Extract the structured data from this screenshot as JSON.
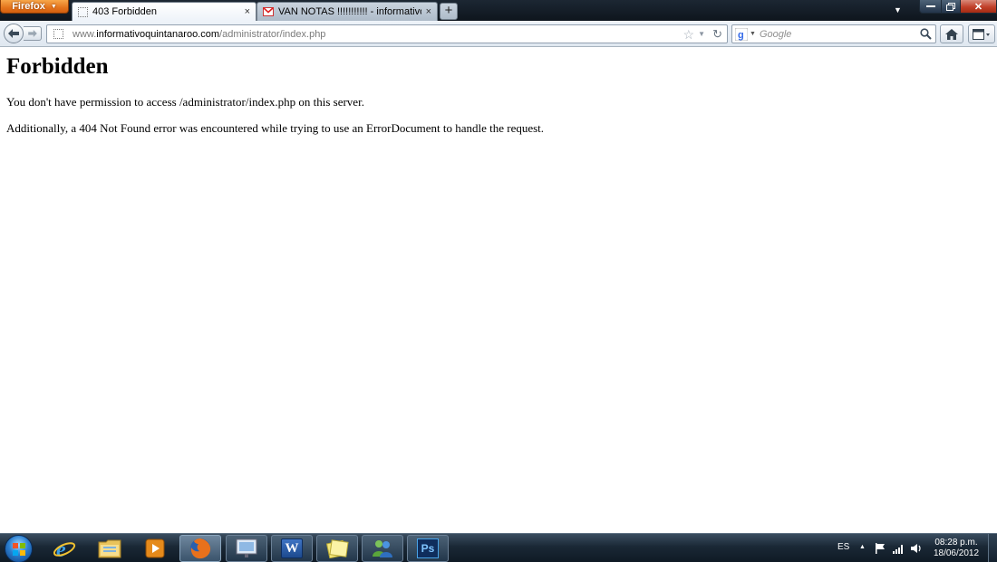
{
  "browser": {
    "menu_button": "Firefox",
    "tabs": [
      {
        "label": "403 Forbidden",
        "active": true
      },
      {
        "label": "VAN NOTAS !!!!!!!!!!! - informativoqui...",
        "active": false
      }
    ],
    "new_tab": "+",
    "tab_close": "×"
  },
  "navbar": {
    "url_prefix": "www.",
    "url_domain": "informativoquintanaroo.com",
    "url_path": "/administrator/index.php",
    "search_placeholder": "Google"
  },
  "page": {
    "heading": "Forbidden",
    "paragraphs": [
      "You don't have permission to access /administrator/index.php on this server.",
      "Additionally, a 404 Not Found error was encountered while trying to use an ErrorDocument to handle the request."
    ]
  },
  "taskbar": {
    "pinned": [
      "windows-start",
      "internet-explorer",
      "windows-explorer",
      "media-player",
      "firefox",
      "presentation",
      "word",
      "sticky-notes",
      "messenger",
      "photoshop"
    ],
    "photoshop_label": "Ps",
    "word_label": "W",
    "language": "ES",
    "time": "08:28 p.m.",
    "date": "18/06/2012"
  },
  "colors": {
    "firefox_orange": "#e4741c",
    "taskbar_dark": "#1a2836",
    "link_gray": "#7a7a7a"
  }
}
